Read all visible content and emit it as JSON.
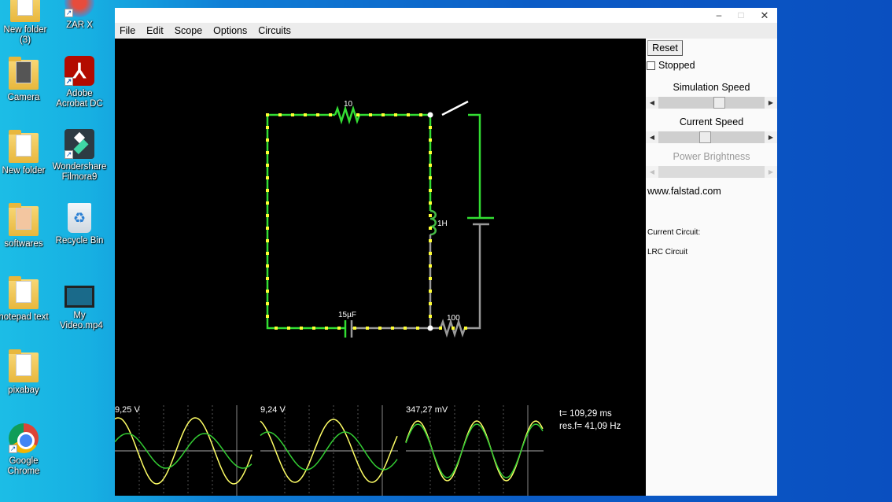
{
  "desktop": {
    "icons": [
      {
        "label": "New folder (3)",
        "type": "folder"
      },
      {
        "label": "ZAR X",
        "type": "app"
      },
      {
        "label": "Camera",
        "type": "folder"
      },
      {
        "label": "Adobe Acrobat DC",
        "type": "app"
      },
      {
        "label": "New folder",
        "type": "folder"
      },
      {
        "label": "Wondershare Filmora9",
        "type": "app"
      },
      {
        "label": "softwares",
        "type": "folder"
      },
      {
        "label": "Recycle Bin",
        "type": "system"
      },
      {
        "label": "notepad text",
        "type": "folder"
      },
      {
        "label": "My Video.mp4",
        "type": "file"
      },
      {
        "label": "pixabay",
        "type": "folder"
      },
      {
        "label": "Google Chrome",
        "type": "app"
      }
    ]
  },
  "window": {
    "controls": {
      "minimize": "–",
      "maximize": "□",
      "close": "✕"
    },
    "menu": [
      "File",
      "Edit",
      "Scope",
      "Options",
      "Circuits"
    ]
  },
  "circuit": {
    "components": {
      "resistor_top": "10",
      "inductor": "1H",
      "capacitor": "15µF",
      "resistor_bottom": "100"
    },
    "colors": {
      "positive_wire": "#33dd33",
      "neutral_wire": "#999999",
      "current_dot": "#ffff33",
      "switch": "#ffffff"
    }
  },
  "scopes": [
    {
      "label": "9,25 V"
    },
    {
      "label": "9,24 V"
    },
    {
      "label": "347,27 mV"
    }
  ],
  "scope_info": {
    "time": "t= 109,29 ms",
    "res_freq": "res.f= 41,09 Hz"
  },
  "panel": {
    "reset_label": "Reset",
    "stopped_label": "Stopped",
    "stopped_checked": false,
    "simulation_speed_label": "Simulation Speed",
    "simulation_speed_value": 0.58,
    "current_speed_label": "Current Speed",
    "current_speed_value": 0.43,
    "power_brightness_label": "Power Brightness",
    "website": "www.falstad.com",
    "current_circuit_label": "Current Circuit:",
    "current_circuit_name": "LRC Circuit"
  }
}
